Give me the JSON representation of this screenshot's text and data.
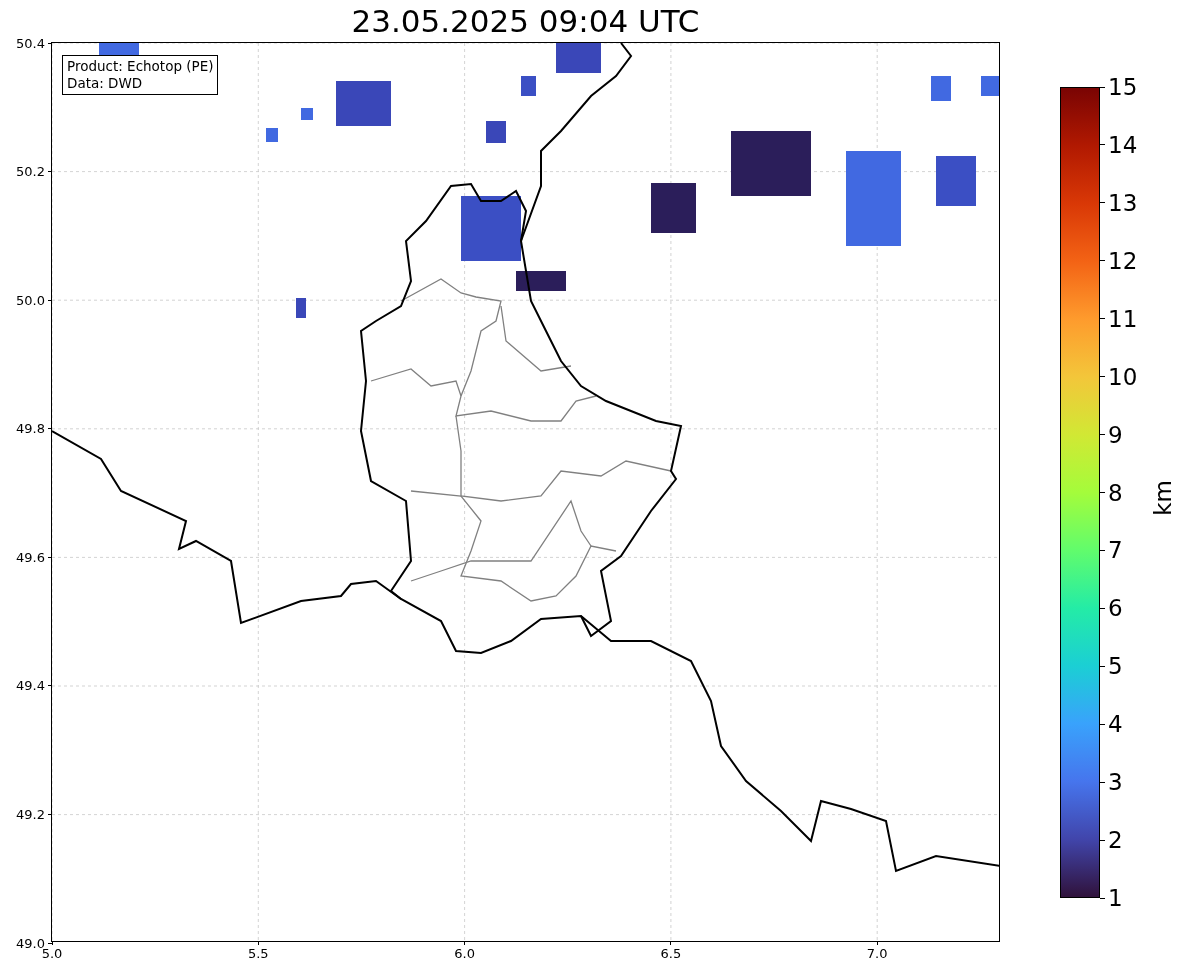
{
  "title": "23.05.2025 09:04 UTC",
  "annotation": [
    "Product: Echotop (PE)",
    "Data: DWD"
  ],
  "x_ticks": [
    "5.0",
    "5.5",
    "6.0",
    "6.5",
    "7.0"
  ],
  "y_ticks": [
    "50.4",
    "50.2",
    "50.0",
    "49.8",
    "49.6",
    "49.4",
    "49.2",
    "49.0"
  ],
  "colorbar": {
    "label": "km",
    "ticks": [
      "15",
      "14",
      "13",
      "12",
      "11",
      "10",
      "9",
      "8",
      "7",
      "6",
      "5",
      "4",
      "3",
      "2",
      "1"
    ]
  }
}
